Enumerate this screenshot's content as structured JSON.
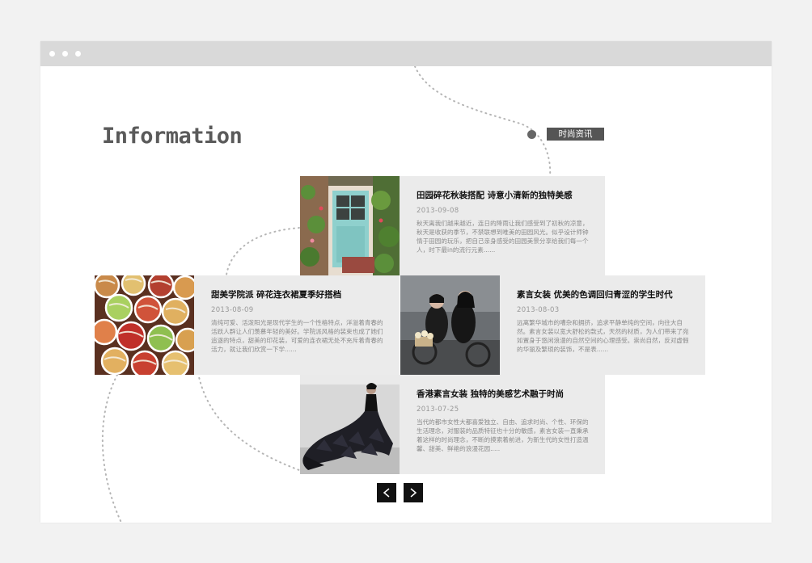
{
  "browser": {
    "dots": [
      "window-dot",
      "window-dot",
      "window-dot"
    ]
  },
  "header": {
    "title": "Information",
    "tag": "时尚资讯"
  },
  "articles": [
    {
      "title": "田园碎花秋装搭配  诗意小清新的独特美感",
      "date": "2013-09-08",
      "excerpt": "秋天离我们越来越近，连日的降雨让我们感受到了初秋的凉意，秋天是收获的季节，不禁联想到唯美的田园风光。似乎设计师钟情于田园的玩乐，把自己亲身感受的田园美景分享给我们每一个人，时下最in的流行元素......",
      "image": "green-door"
    },
    {
      "title": "甜美学院派  碎花连衣裙夏季好搭档",
      "date": "2013-08-09",
      "excerpt": "清纯可爱、活泼阳光是现代学生的一个性格特点，洋溢着青春的活跃人群让人们羡慕年轻的美好。学院派风格的装束也成了她们追逐的特点，甜美的印花装，可爱的连衣裙无处不充斥着青春的活力，就让我们欣赏一下学......",
      "image": "candy-balls"
    },
    {
      "title": "素言女装  优美的色调回归青涩的学生时代",
      "date": "2013-08-03",
      "excerpt": "远离繁华城市的嘈杂和拥挤，追求平静单纯的空间，向往大自然。素言女装以宽大舒松的款式，天然的材质，为人们带来了宛如置身于悠闲浪漫的自然空间的心理感受。崇尚自然，反对虚假的华丽及繁琐的装饰，不是表......",
      "image": "bicycle-couple"
    },
    {
      "title": "香港素言女装 独特的美感艺术融于时尚",
      "date": "2013-07-25",
      "excerpt": "当代的都市女性大都喜爱独立、自由、追求时尚、个性、环保的生活理念，对服装的品质特征也十分的敏感，素言女装一直秉承着这样的时尚理念，不断的摸索着前进，为新生代的女性打造温馨、甜美、鲜艳的浪漫花园.....",
      "image": "black-gown"
    }
  ],
  "pagination": {
    "prev_icon": "chevron-left-icon",
    "next_icon": "chevron-right-icon"
  },
  "colors": {
    "card_bg": "#ebebeb",
    "tag_bg": "#555555",
    "nav_bg": "#111111",
    "browser_bar": "#d9d9d9"
  }
}
